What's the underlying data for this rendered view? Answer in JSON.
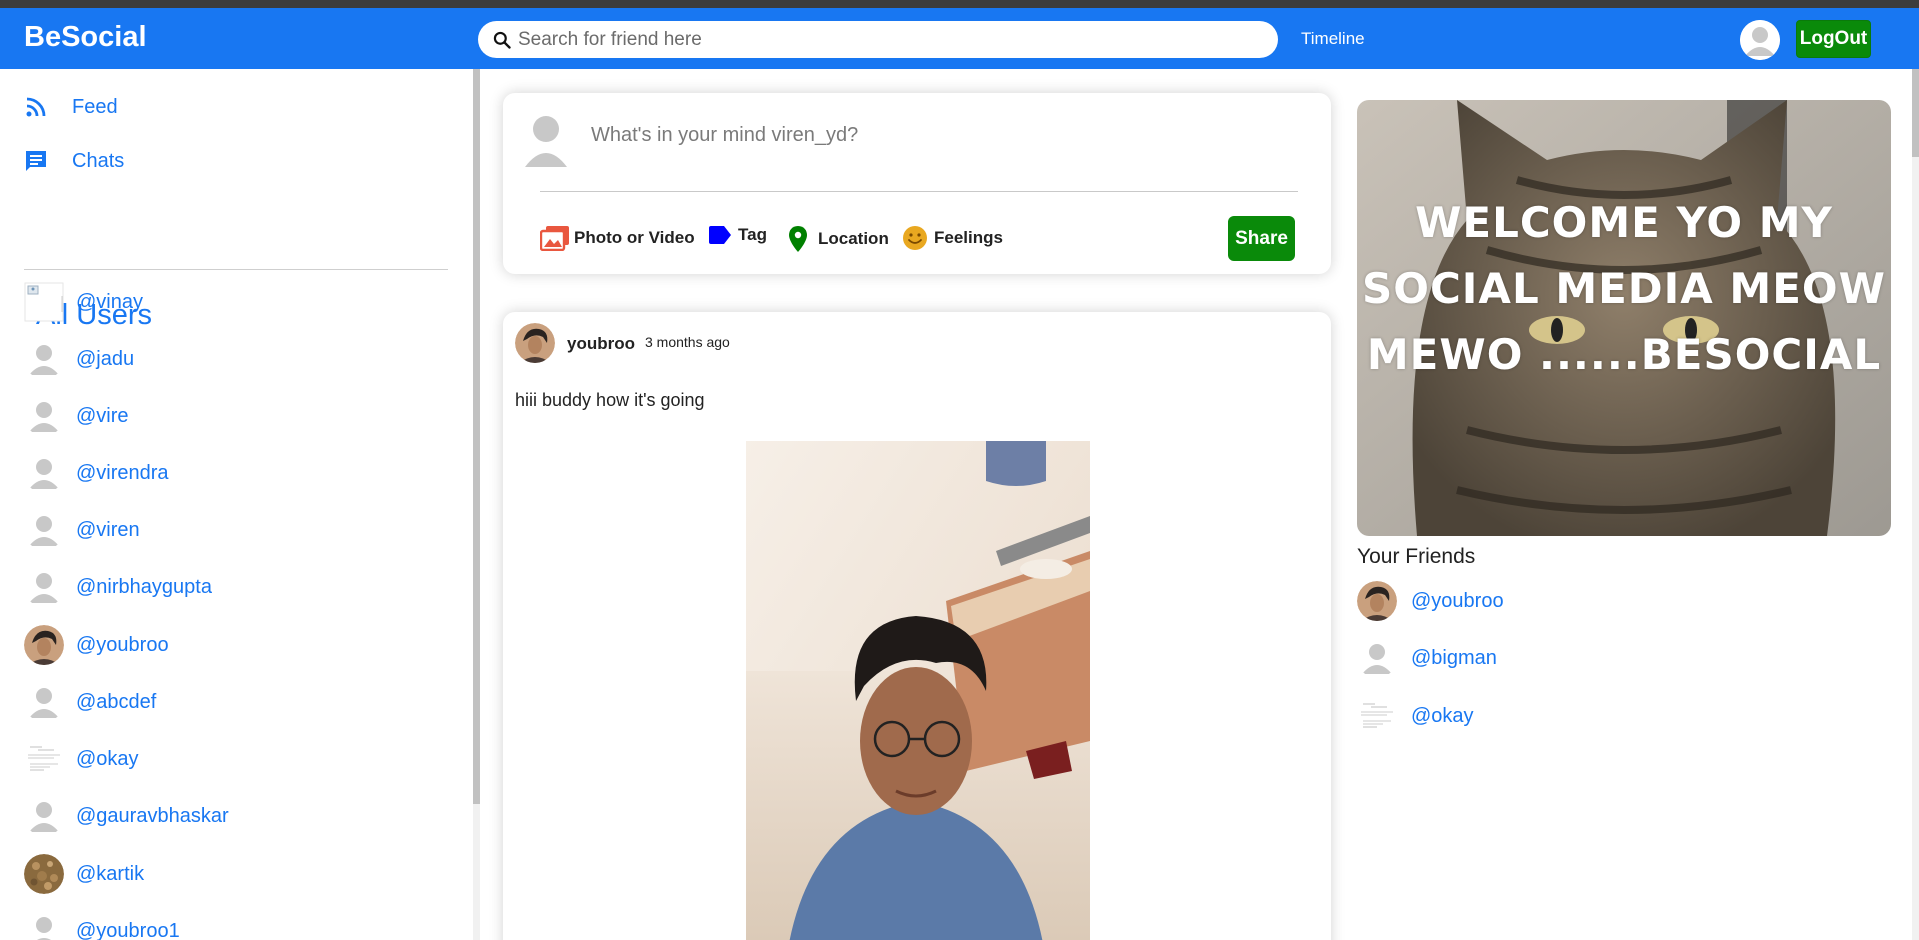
{
  "header": {
    "logo": "BeSocial",
    "search_placeholder": "Search for friend here",
    "timeline_label": "Timeline",
    "logout_label": "LogOut"
  },
  "sidebar": {
    "menu": [
      {
        "label": "Feed",
        "icon": "rss-feed-icon"
      },
      {
        "label": "Chats",
        "icon": "chat-icon"
      }
    ],
    "all_users_title": "All Users",
    "users": [
      {
        "name": "@vinay",
        "avatar": "broken-image"
      },
      {
        "name": "@jadu",
        "avatar": "default"
      },
      {
        "name": "@vire",
        "avatar": "default"
      },
      {
        "name": "@virendra",
        "avatar": "default"
      },
      {
        "name": "@viren",
        "avatar": "default"
      },
      {
        "name": "@nirbhaygupta",
        "avatar": "default"
      },
      {
        "name": "@youbroo",
        "avatar": "photo"
      },
      {
        "name": "@abcdef",
        "avatar": "default"
      },
      {
        "name": "@okay",
        "avatar": "document"
      },
      {
        "name": "@gauravbhaskar",
        "avatar": "default"
      },
      {
        "name": "@kartik",
        "avatar": "photo"
      },
      {
        "name": "@youbroo1",
        "avatar": "default"
      }
    ]
  },
  "share": {
    "placeholder": "What's in your mind viren_yd?",
    "options": [
      {
        "label": "Photo or Video",
        "icon": "photo-library-icon",
        "color": "#e9573f"
      },
      {
        "label": "Tag",
        "icon": "label-icon",
        "color": "#0000ff"
      },
      {
        "label": "Location",
        "icon": "location-pin-icon",
        "color": "#008000"
      },
      {
        "label": "Feelings",
        "icon": "emoji-icon",
        "color": "#e9a820"
      }
    ],
    "button_label": "Share"
  },
  "post": {
    "username": "youbroo",
    "time": "3 months ago",
    "text": "hiii buddy how it's going"
  },
  "right": {
    "welcome_text": "WELCOME YO MY SOCIAL MEDIA MEOW MEWO ......BESOCIAL",
    "friends_title": "Your Friends",
    "friends": [
      {
        "name": "@youbroo",
        "avatar": "photo"
      },
      {
        "name": "@bigman",
        "avatar": "default"
      },
      {
        "name": "@okay",
        "avatar": "document"
      }
    ]
  },
  "colors": {
    "brand": "#1877f2",
    "share_button": "#0a8a0a",
    "logout_button": "#0a8a0a"
  }
}
